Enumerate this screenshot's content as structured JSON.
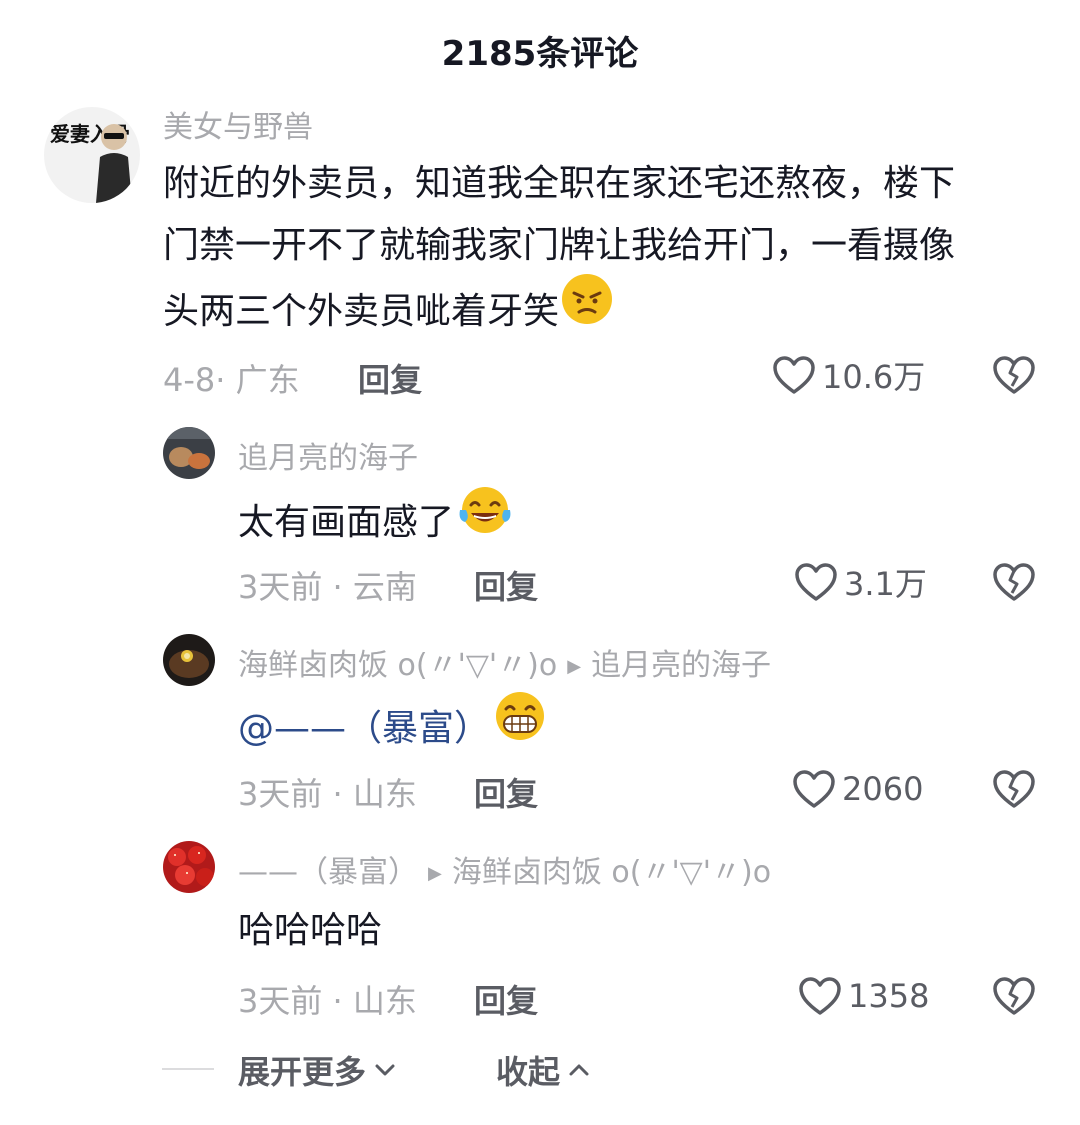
{
  "header": {
    "title": "2185条评论"
  },
  "comments": [
    {
      "author": "美女与野兽",
      "avatar_text": "爱妻入骨",
      "text": "附近的外卖员，知道我全职在家还宅还熬夜，楼下门禁一开不了就输我家门牌让我给开门，一看摄像头两三个外卖员呲着牙笑",
      "text_lines": [
        "附近的外卖员，知道我全职在家还宅还熬夜，楼下",
        "门禁一开不了就输我家门牌让我给开门，一看摄像",
        "头两三个外卖员呲着牙笑"
      ],
      "emoji": "angry-face-emoji",
      "meta": "4-8· 广东",
      "reply_label": "回复",
      "likes": "10.6万"
    },
    {
      "author": "追月亮的海子",
      "text": "太有画面感了",
      "emoji": "tears-of-joy-emoji",
      "meta": "3天前 · 云南",
      "reply_label": "回复",
      "likes": "3.1万"
    },
    {
      "author": "海鲜卤肉饭 o(〃'▽'〃)o",
      "reply_to": "追月亮的海子",
      "text": "@——（暴富）",
      "emoji": "grinning-face-emoji",
      "meta": "3天前 · 山东",
      "reply_label": "回复",
      "likes": "2060"
    },
    {
      "author": "——（暴富）",
      "reply_to": "海鲜卤肉饭 o(〃'▽'〃)o",
      "text": "哈哈哈哈",
      "meta": "3天前 · 山东",
      "reply_label": "回复",
      "likes": "1358"
    }
  ],
  "footer": {
    "expand_label": "展开更多",
    "collapse_label": "收起"
  },
  "colors": {
    "text": "#161823",
    "muted": "#a8a9ad",
    "action": "#5a5c63",
    "mention": "#2c4b8a"
  }
}
